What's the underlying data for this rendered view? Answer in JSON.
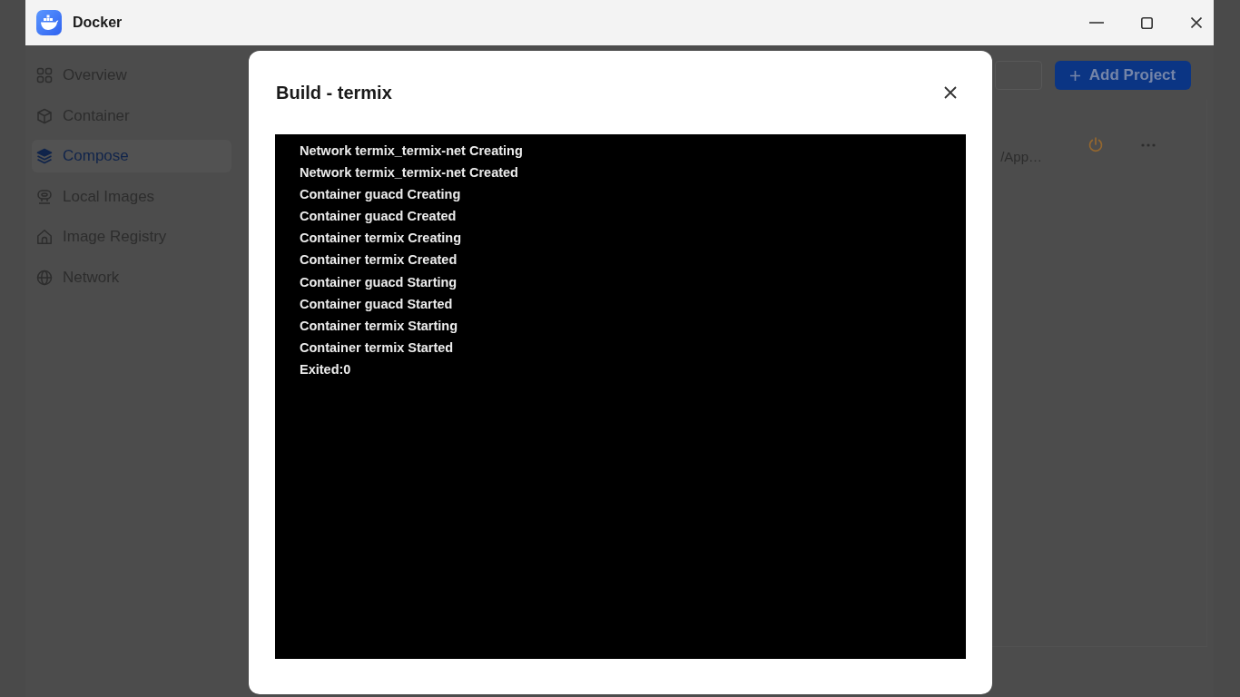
{
  "window": {
    "title": "Docker"
  },
  "sidebar": {
    "items": [
      {
        "label": "Overview",
        "selected": false
      },
      {
        "label": "Container",
        "selected": false
      },
      {
        "label": "Compose",
        "selected": true
      },
      {
        "label": "Local Images",
        "selected": false
      },
      {
        "label": "Image Registry",
        "selected": false
      },
      {
        "label": "Network",
        "selected": false
      }
    ]
  },
  "toolbar": {
    "add_button": {
      "label": "Add Project"
    }
  },
  "project_rows": [
    {
      "visible_text": "/App…"
    }
  ],
  "build_dialog": {
    "title": "Build - termix",
    "log_lines": [
      "Network termix_termix-net Creating",
      "Network termix_termix-net Created",
      "Container guacd Creating",
      "Container guacd Created",
      "Container termix Creating",
      "Container termix Created",
      "Container guacd Starting",
      "Container guacd Started",
      "Container termix Starting",
      "Container termix Started",
      "Exited:0"
    ]
  }
}
